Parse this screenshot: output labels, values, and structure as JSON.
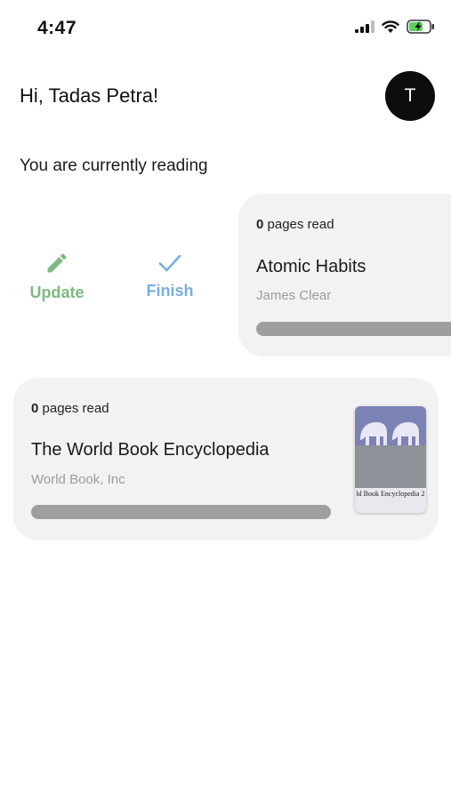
{
  "status_bar": {
    "time": "4:47",
    "icons": [
      "signal-icon",
      "wifi-icon",
      "battery-charging-icon"
    ]
  },
  "header": {
    "greeting": "Hi, Tadas Petra!",
    "avatar_initial": "T"
  },
  "section": {
    "title": "You are currently reading"
  },
  "actions": {
    "update_label": "Update",
    "finish_label": "Finish",
    "update_icon": "pencil-icon",
    "finish_icon": "check-icon",
    "update_color": "#7dba7f",
    "finish_color": "#7aaedb"
  },
  "books": [
    {
      "pages_count": "0",
      "pages_suffix": "pages read",
      "title": "Atomic Habits",
      "author": "James Clear",
      "progress": 0
    },
    {
      "pages_count": "0",
      "pages_suffix": "pages read",
      "title": "The World Book Encyclopedia",
      "author": "World Book, Inc",
      "progress": 0,
      "cover_text": "ld Book Encyclopedia 2"
    }
  ],
  "colors": {
    "background": "#ffffff",
    "card": "#f2f2f2",
    "progress_track": "#9e9e9e",
    "avatar": "#0d0d0d"
  }
}
